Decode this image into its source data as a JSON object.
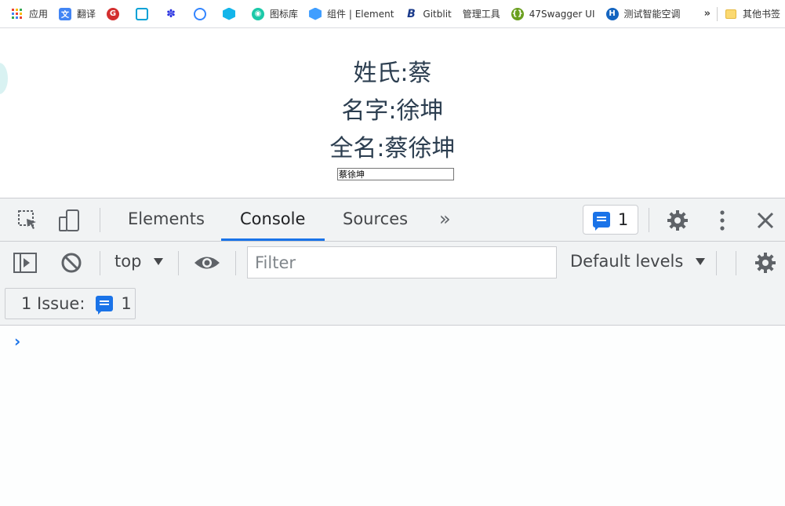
{
  "bookmarks": [
    {
      "label": "应用",
      "icon": "apps-grid-icon",
      "color": "#4285f4"
    },
    {
      "label": "翻译",
      "icon": "translate-icon",
      "color": "#4285f4"
    },
    {
      "label": "",
      "icon": "red-g-icon",
      "color": "#d32f2f"
    },
    {
      "label": "",
      "icon": "bilibili-icon",
      "color": "#00a1d6"
    },
    {
      "label": "",
      "icon": "baidu-paw-icon",
      "color": "#2932e1"
    },
    {
      "label": "",
      "icon": "search-engine-icon",
      "color": "#3385ff"
    },
    {
      "label": "",
      "icon": "hex-app-icon",
      "color": "#13b5ea"
    },
    {
      "label": "图标库",
      "icon": "iconfont-icon",
      "color": "#1bc9a8"
    },
    {
      "label": "组件 | Element",
      "icon": "element-icon",
      "color": "#409eff"
    },
    {
      "label": "Gitblit",
      "icon": "gitblit-icon",
      "color": "#1a3a8a"
    },
    {
      "label": "管理工具",
      "icon": "",
      "color": ""
    },
    {
      "label": "47Swagger UI",
      "icon": "swagger-icon",
      "color": "#6a9f1f"
    },
    {
      "label": "测试智能空调",
      "icon": "hvac-icon",
      "color": "#1565c0"
    }
  ],
  "bookmarks_more": "»",
  "other_bookmarks": "其他书签",
  "page": {
    "surname": "姓氏:蔡",
    "given_name": "名字:徐坤",
    "full_name": "全名:蔡徐坤",
    "full_name_input": "蔡徐坤"
  },
  "devtools": {
    "tabs": [
      "Elements",
      "Console",
      "Sources"
    ],
    "active_tab": "Console",
    "issues_count": "1",
    "context": "top",
    "filter_placeholder": "Filter",
    "levels": "Default levels",
    "issues_label": "1 Issue:",
    "issues_badge_count": "1",
    "prompt": "›"
  },
  "colors": {
    "accent": "#1a73e8",
    "heading": "#2c3e50"
  }
}
